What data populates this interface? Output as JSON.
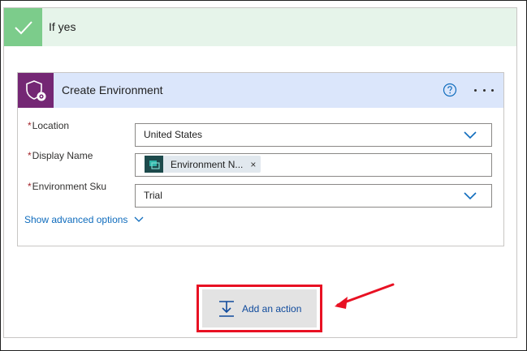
{
  "branch": {
    "title": "If yes"
  },
  "action_card": {
    "title": "Create Environment",
    "connector_icon": "shield-gear-icon",
    "help_icon": "question-circle-icon",
    "more_icon": "ellipsis-icon",
    "fields": [
      {
        "required_mark": "*",
        "label": "Location",
        "value": "United States",
        "type": "dropdown"
      },
      {
        "required_mark": "*",
        "label": "Display Name",
        "token_label": "Environment N...",
        "token_close": "×",
        "type": "token"
      },
      {
        "required_mark": "*",
        "label": "Environment Sku",
        "value": "Trial",
        "type": "dropdown"
      }
    ],
    "advanced_link": "Show advanced options"
  },
  "add_action": {
    "label": "Add an action",
    "icon": "insert-step-icon"
  },
  "annotation": {
    "highlight_color": "#e81123",
    "arrow_color": "#e81123"
  },
  "colors": {
    "branch_header_bg": "#e6f4ea",
    "check_bg": "#7ccc8b",
    "card_header_bg": "#dbe6fb",
    "connector_bg": "#742774",
    "link_blue": "#0f6cbd",
    "required_red": "#a4262c"
  }
}
